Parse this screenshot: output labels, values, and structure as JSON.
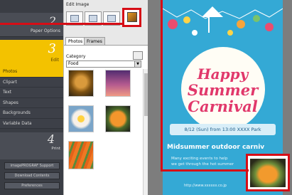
{
  "sidebar": {
    "step2": {
      "number": "2",
      "label": "Paper Options"
    },
    "step3": {
      "number": "3",
      "label": "Edit"
    },
    "menu_items": [
      {
        "label": "Photos",
        "active": true
      },
      {
        "label": "Clipart",
        "active": false
      },
      {
        "label": "Text",
        "active": false
      },
      {
        "label": "Shapes",
        "active": false
      },
      {
        "label": "Backgrounds",
        "active": false
      },
      {
        "label": "Variable Data",
        "active": false
      }
    ],
    "step4": {
      "number": "4",
      "label": "Print"
    },
    "buttons": [
      {
        "label": "imagePROGRAF Support"
      },
      {
        "label": "Download Contents"
      },
      {
        "label": "Preferences"
      }
    ]
  },
  "edit_panel": {
    "title": "Edit Image",
    "tabs": [
      {
        "label": "Photos",
        "active": true
      },
      {
        "label": "Frames",
        "active": false
      }
    ],
    "category_label": "Category",
    "category_value": "Food",
    "thumbnail_names": [
      "lion",
      "sunset-sky",
      "flower",
      "papaya",
      "carrots"
    ]
  },
  "poster": {
    "title_line1": "Happy",
    "title_line2": "Summer",
    "title_line3": "Carnival",
    "date_banner": "8/12 (Sun) from 13:00  XXXX Park",
    "subheading": "Midsummer outdoor carniv",
    "body_line1": "Many exciting events to help",
    "body_line2": "we get through the hot summer",
    "url": "http://www.xxxxxx.co.jp"
  },
  "colors": {
    "sidebar_bg": "#3a3d44",
    "accent_yellow": "#f3c200",
    "highlight_red": "#d60d16",
    "poster_bg": "#34a9d5",
    "title_pink": "#e1386b"
  }
}
